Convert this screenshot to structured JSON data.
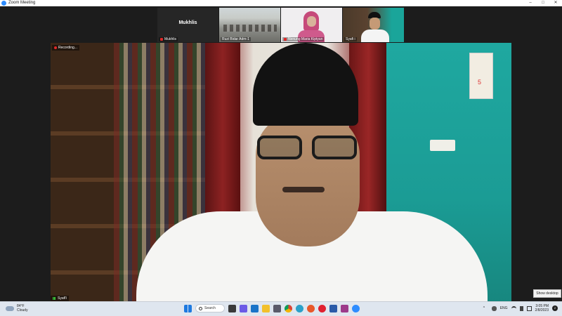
{
  "window": {
    "title": "Zoom Meeting",
    "controls": [
      "–",
      "□",
      "✕"
    ]
  },
  "participants": [
    {
      "name": "Mukhlis",
      "caption": "Mukhlis",
      "video": false
    },
    {
      "name": "Ruzi Bidar Adm-1",
      "video": true
    },
    {
      "name": "Nenung Maria Kiptyan",
      "video": true
    },
    {
      "name": "Syafi i",
      "video": true
    }
  ],
  "main_video": {
    "recording_label": "Recording...",
    "speaker_label": "Syafi'i"
  },
  "wall_calendar_number": "5",
  "show_desktop_tooltip": "Show desktop",
  "taskbar": {
    "weather_temp": "84°F",
    "weather_desc": "Cloudy",
    "search_label": "Search",
    "language": "ENG",
    "time": "3:05 PM",
    "date": "2/8/2023",
    "notification_count": "2"
  },
  "colors": {
    "accent": "#2d8cff",
    "recording": "#e02828",
    "wall": "#1fa8a0"
  }
}
